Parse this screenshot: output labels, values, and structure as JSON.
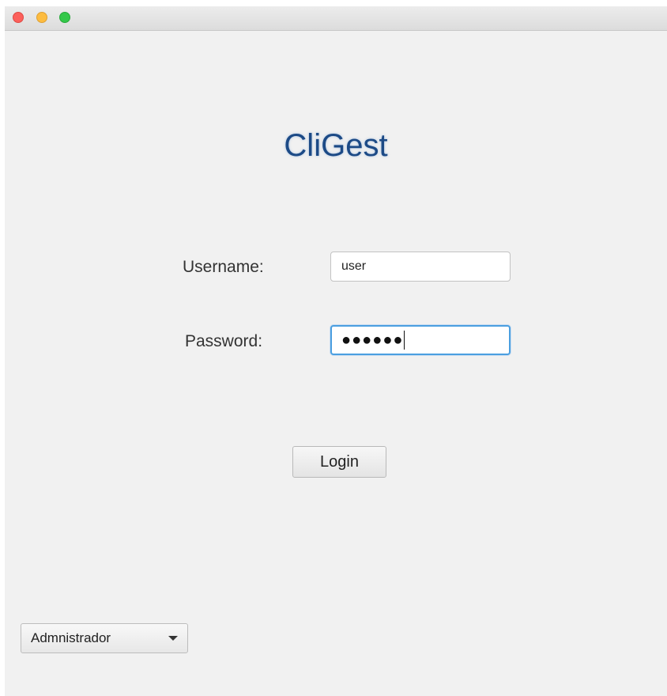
{
  "app": {
    "title": "CliGest"
  },
  "form": {
    "username_label": "Username:",
    "username_value": "user",
    "password_label": "Password:",
    "password_mask": "●●●●●●",
    "login_label": "Login"
  },
  "role_select": {
    "selected": "Admnistrador",
    "icon": "chevron-down-icon"
  },
  "colors": {
    "title": "#1c4a86",
    "focus_border": "#4b9fe0",
    "window_bg": "#f1f1f1"
  }
}
